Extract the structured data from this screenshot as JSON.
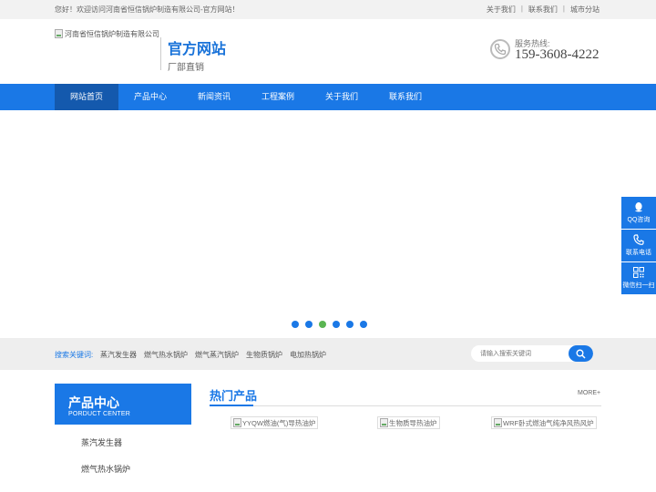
{
  "topbar": {
    "welcome": "您好！欢迎访问河南省恒信锅炉制造有限公司-官方网站！",
    "links": [
      "关于我们",
      "联系我们",
      "城市分站"
    ]
  },
  "header": {
    "logo_alt": "河南省恒信锅炉制造有限公司-官方网站",
    "brand_title": "官方网站",
    "brand_sub": "厂部直销",
    "hotline_label": "服务热线:",
    "hotline_number": "159-3608-4222"
  },
  "nav": {
    "items": [
      "网站首页",
      "产品中心",
      "新闻资讯",
      "工程案例",
      "关于我们",
      "联系我们"
    ],
    "active_index": 0
  },
  "banner": {
    "dot_count": 6,
    "active_dot": 2
  },
  "search": {
    "label": "搜索关键词:",
    "keywords": [
      "蒸汽发生器",
      "燃气热水锅炉",
      "燃气蒸汽锅炉",
      "生物质锅炉",
      "电加热锅炉"
    ],
    "placeholder": "请输入搜索关键词"
  },
  "product_center": {
    "title": "产品中心",
    "subtitle": "PORDUCT CENTER",
    "items": [
      "蒸汽发生器",
      "燃气热水锅炉"
    ]
  },
  "hot_products": {
    "title": "热门产品",
    "more": "MORE+",
    "items": [
      "YYQW燃油(气)导热油炉",
      "生物质导热油炉",
      "WRF卧式燃油气纯净风热风炉"
    ]
  },
  "float_bar": {
    "items": [
      {
        "label": "QQ咨询",
        "icon": "qq-icon"
      },
      {
        "label": "联系电话",
        "icon": "phone-icon"
      },
      {
        "label": "微信扫一扫",
        "icon": "qrcode-icon"
      }
    ]
  },
  "colors": {
    "primary": "#1a78e6",
    "nav_active": "#1459ad",
    "dot_active": "#5ab552"
  }
}
